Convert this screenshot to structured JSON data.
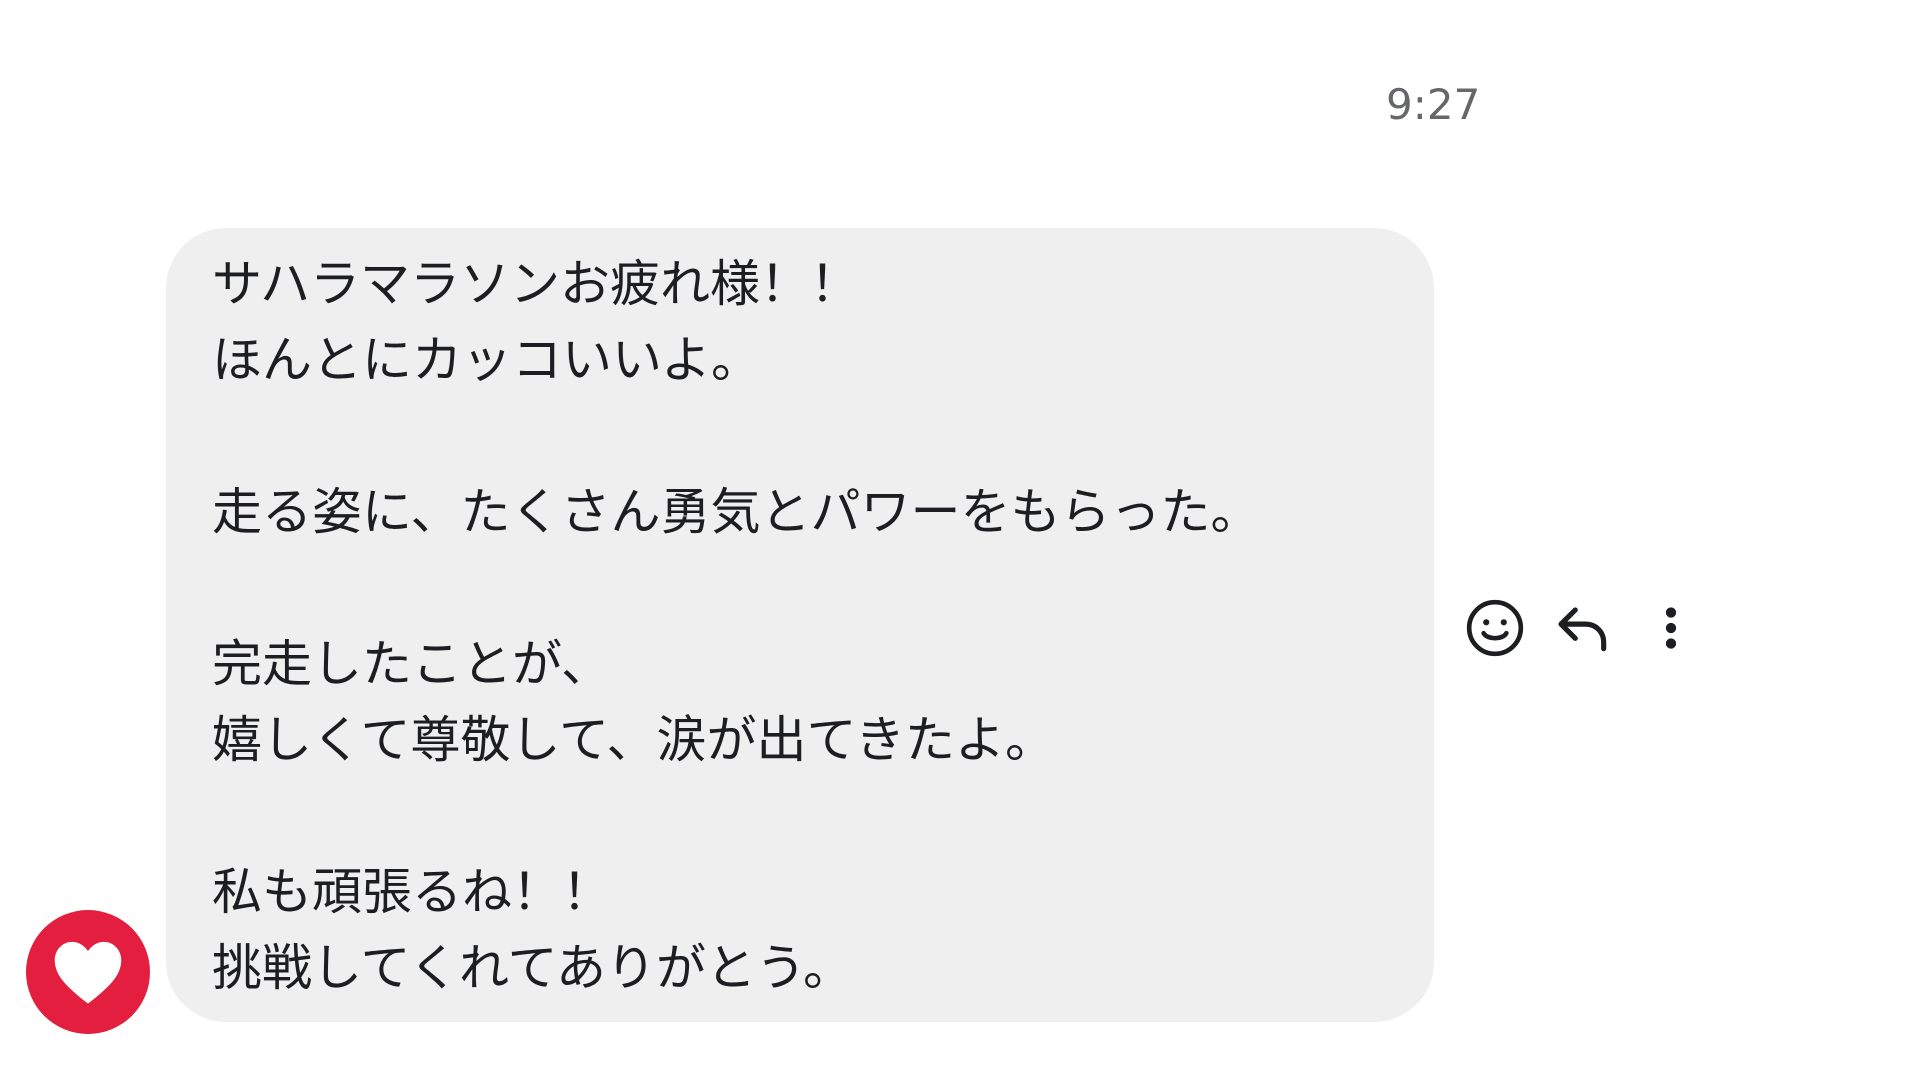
{
  "message": {
    "timestamp": "9:27",
    "lines": [
      "サハラマラソンお疲れ様！！",
      "ほんとにカッコいいよ。",
      "走る姿に、たくさん勇気とパワーをもらった。",
      "完走したことが、",
      "嬉しくて尊敬して、涙が出てきたよ。",
      "私も頑張るね！！",
      "挑戦してくれてありがとう。"
    ],
    "bubble_color": "#efefef",
    "text_color": "#1c1e21"
  },
  "reaction": {
    "icon": "heart-icon",
    "badge_color": "#e41e3f"
  },
  "actions": [
    {
      "name": "react",
      "icon": "smiley-icon"
    },
    {
      "name": "reply",
      "icon": "reply-arrow-icon"
    },
    {
      "name": "more",
      "icon": "vertical-ellipsis-icon"
    }
  ]
}
